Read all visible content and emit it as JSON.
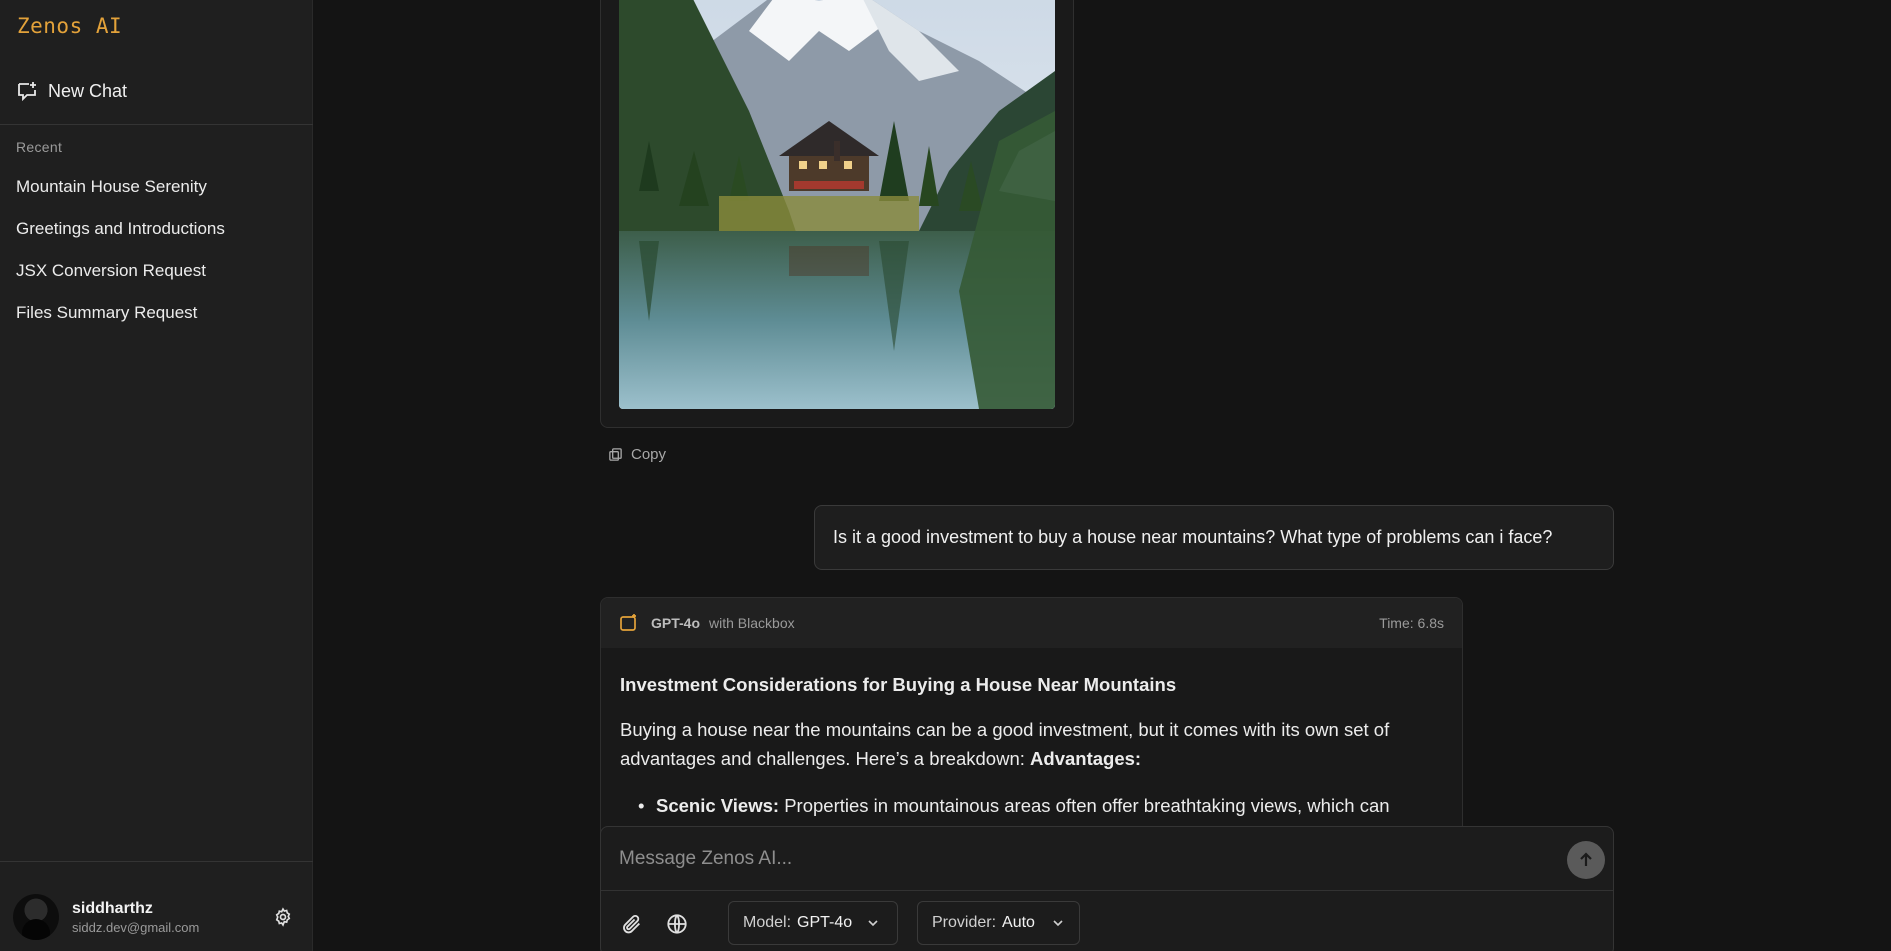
{
  "app": {
    "brand": "Zenos AI"
  },
  "sidebar": {
    "new_chat_label": "New Chat",
    "recent_label": "Recent",
    "recent": [
      "Mountain House Serenity",
      "Greetings and Introductions",
      "JSX Conversion Request",
      "Files Summary Request"
    ],
    "user": {
      "name": "siddharthz",
      "email": "siddz.dev@gmail.com"
    }
  },
  "chat": {
    "copy_label": "Copy",
    "user_message": "Is it a good investment to buy a house near mountains? What type of problems can i face?",
    "response": {
      "model": "GPT-4o",
      "provider_note": "with Blackbox",
      "time": "Time: 6.8s",
      "title": "Investment Considerations for Buying a House Near Mountains",
      "paragraph": "Buying a house near the mountains can be a good investment, but it comes with its own set of advantages and challenges. Here’s a breakdown: ",
      "paragraph_bold": "Advantages:",
      "bullet_bold": "Scenic Views:",
      "bullet_text": " Properties in mountainous areas often offer breathtaking views, which can"
    }
  },
  "composer": {
    "placeholder": "Message Zenos AI...",
    "model_key": "Model:",
    "model_value": "GPT-4o",
    "provider_key": "Provider:",
    "provider_value": "Auto"
  },
  "colors": {
    "accent": "#e3a23a",
    "background": "#141414",
    "sidebar": "#1f1f1f"
  }
}
